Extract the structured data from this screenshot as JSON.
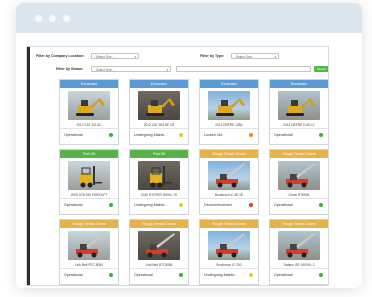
{
  "filters": {
    "company_location_label": "Filter by Company Location:",
    "company_location_value": "- Select One -",
    "type_label": "Filter by Type:",
    "type_value": "- Select One -",
    "status_label": "Filter by Status:",
    "status_value": "- Select One -",
    "search_value": "",
    "search_button_label": "Search"
  },
  "colors": {
    "excavator_header": "#5b9bd5",
    "forklift_header": "#59b248",
    "crane_header": "#e8b14a",
    "status_green": "#3fae48",
    "status_yellow": "#d9d227",
    "status_orange": "#ef8a2c",
    "status_red": "#e53935"
  },
  "cards": [
    {
      "type": "Excavator",
      "name": "2012 CAT 301.5C",
      "status": "Operational",
      "status_color": "#3fae48",
      "header_color": "#5b9bd5",
      "image": "excavator-photo"
    },
    {
      "type": "Excavator",
      "name": "2012 CAT 305.5E CR",
      "status": "Undergoing Mainte...",
      "status_color": "#d9d227",
      "header_color": "#5b9bd5",
      "image": "excavator-photo"
    },
    {
      "type": "Excavator",
      "name": "2012 DEERE 135D",
      "status": "Locked Out",
      "status_color": "#ef8a2c",
      "header_color": "#5b9bd5",
      "image": "excavator-photo"
    },
    {
      "type": "Excavator",
      "name": "2014 DEERE D 60 LC",
      "status": "Operational",
      "status_color": "#3fae48",
      "header_color": "#5b9bd5",
      "image": "excavator-photo"
    },
    {
      "type": "Fork lift",
      "name": "2005 JCB 930 FORKLIFT",
      "status": "Operational",
      "status_color": "#3fae48",
      "header_color": "#59b248",
      "image": "forklift-photo"
    },
    {
      "type": "Fork lift",
      "name": "2015 HYSTER H50XL-70",
      "status": "Undergoing Mainte...",
      "status_color": "#d9d227",
      "header_color": "#59b248",
      "image": "forklift-photo"
    },
    {
      "type": "Rough Terrain Crane",
      "name": "Broderson IC-80 1E",
      "status": "Decommissioned",
      "status_color": "#e53935",
      "header_color": "#e8b14a",
      "image": "crane-photo"
    },
    {
      "type": "Rough Terrain Crane",
      "name": "Grove RT890E",
      "status": "Operational",
      "status_color": "#3fae48",
      "header_color": "#e8b14a",
      "image": "crane-photo"
    },
    {
      "type": "Rough Terrain Crane",
      "name": "Link-Belt RTC-8050",
      "status": "Operational",
      "status_color": "#3fae48",
      "header_color": "#e8b14a",
      "image": "crane-photo"
    },
    {
      "type": "Rough Terrain Crane",
      "name": "Link-Belt RTC8065",
      "status": "Operational",
      "status_color": "#3fae48",
      "header_color": "#e8b14a",
      "image": "crane-photo"
    },
    {
      "type": "Rough Terrain Crane",
      "name": "Broderson IC 250",
      "status": "Undergoing Mainte...",
      "status_color": "#d9d227",
      "header_color": "#e8b14a",
      "image": "crane-photo"
    },
    {
      "type": "Rough Terrain Crane",
      "name": "Tadano GR-1600XL-2",
      "status": "Operational",
      "status_color": "#3fae48",
      "header_color": "#e8b14a",
      "image": "crane-photo"
    }
  ]
}
